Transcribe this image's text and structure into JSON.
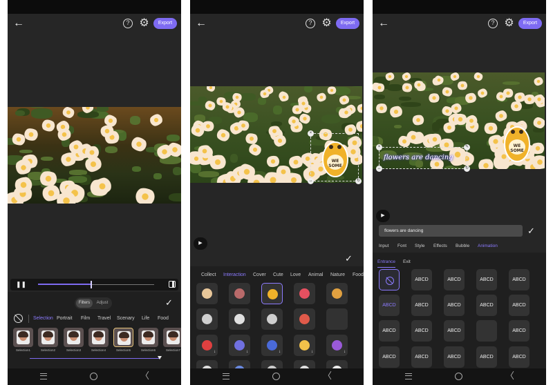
{
  "common": {
    "export_label": "Export",
    "help_glyph": "?",
    "back_glyph": "←",
    "gear_glyph": "⚙",
    "play_glyph": "▶",
    "check_glyph": "✓",
    "nav_back_glyph": "〈",
    "accent_color": "#7e6bf2"
  },
  "screen1": {
    "pause_glyph": "❚❚",
    "toggle_filters": "Filters",
    "toggle_adjust": "Adjust",
    "categories": [
      "Selection",
      "Portrait",
      "Film",
      "Travel",
      "Scenary",
      "Life",
      "Food"
    ],
    "active_category": "Selection",
    "filters": [
      "Selection1",
      "Selection2",
      "Selection3",
      "Selection4",
      "Selection5",
      "Selection6",
      "Selection7"
    ],
    "selected_filter": "Selection5",
    "playback_progress": 0.46,
    "filter_intensity": 1.0
  },
  "screen2": {
    "categories": [
      "Collect",
      "Interaction",
      "Cover",
      "Cute",
      "Love",
      "Animal",
      "Nature",
      "Food"
    ],
    "active_category": "Interaction",
    "sticker_text": "WE SOME"
  },
  "screen3": {
    "text_value": "flowers are dancing",
    "overlay_text": "flowers are dancing",
    "sticker_text": "WE SOME",
    "tabs": [
      "Input",
      "Font",
      "Style",
      "Effects",
      "Bubble",
      "Animation"
    ],
    "active_tab": "Animation",
    "animation_tabs": [
      "Entrance",
      "Exit"
    ],
    "active_animation_tab": "Entrance",
    "cells": [
      "ABCD",
      "ABCD",
      "ABCD",
      "ABCD",
      "ABCD",
      "ABCD",
      "ABCD",
      "ABCD",
      "ABCD",
      "ABCD",
      "ABCD",
      "ABCD",
      "ABCD",
      "ABCD",
      "ABCD",
      "ABCD",
      "ABCD",
      "ABCD"
    ]
  }
}
